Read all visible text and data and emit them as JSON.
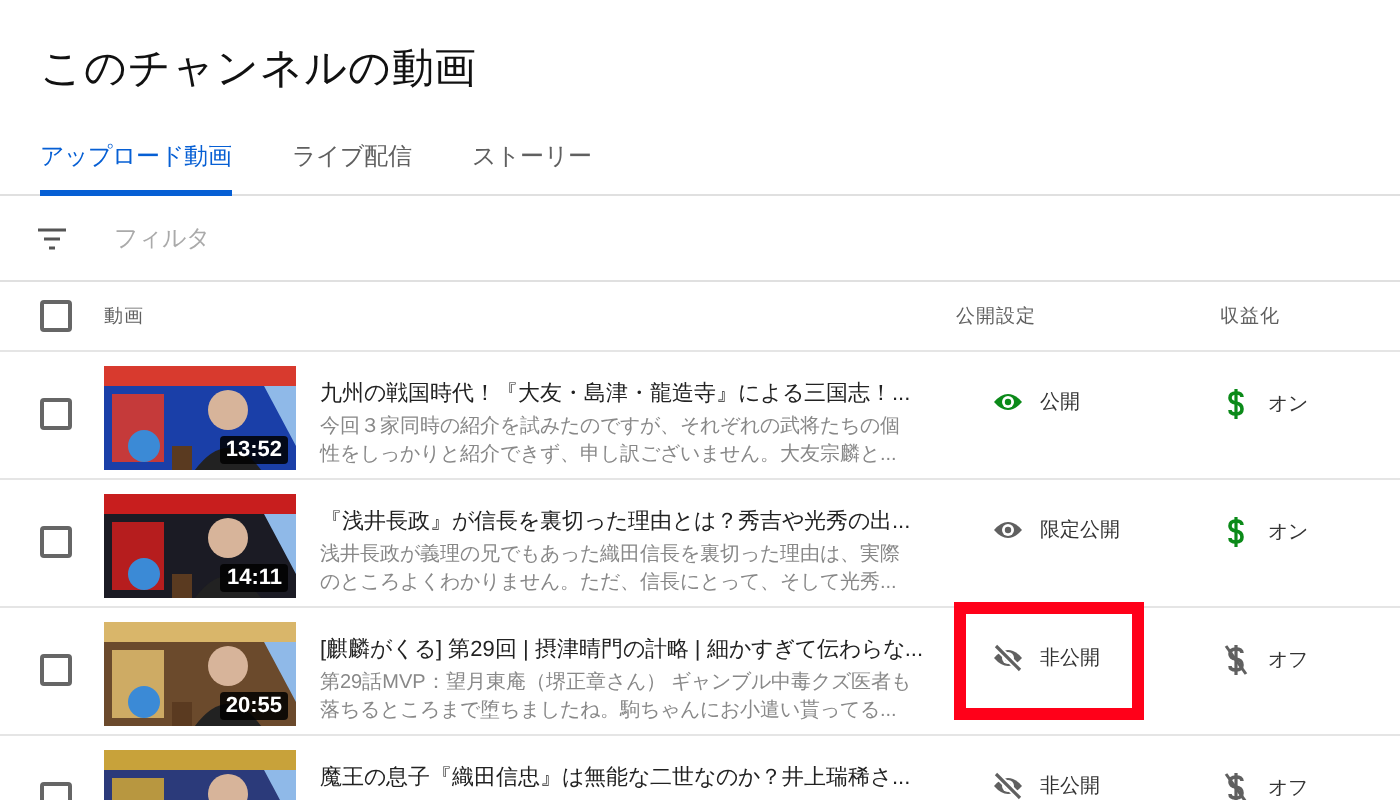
{
  "page": {
    "title": "このチャンネルの動画"
  },
  "tabs": [
    {
      "label": "アップロード動画",
      "selected": true
    },
    {
      "label": "ライブ配信",
      "selected": false
    },
    {
      "label": "ストーリー",
      "selected": false
    }
  ],
  "filter": {
    "placeholder": "フィルタ"
  },
  "table": {
    "select_all": {
      "checked": false
    },
    "columns": [
      "動画",
      "公開設定",
      "収益化"
    ],
    "rows": [
      {
        "checked": false,
        "duration": "13:52",
        "title": "九州の戦国時代！『大友・島津・龍造寺』による三国志！...",
        "description": "今回３家同時の紹介を試みたのですが、それぞれの武将たちの個性をしっかりと紹介できず、申し訳ございません。大友宗麟と...",
        "visibility": {
          "kind": "public",
          "label": "公開"
        },
        "monetization": {
          "kind": "on",
          "label": "オン"
        },
        "highlighted": false
      },
      {
        "checked": false,
        "duration": "14:11",
        "title": "『浅井長政』が信長を裏切った理由とは？秀吉や光秀の出...",
        "description": "浅井長政が義理の兄でもあった織田信長を裏切った理由は、実際のところよくわかりません。ただ、信長にとって、そして光秀...",
        "visibility": {
          "kind": "unlisted",
          "label": "限定公開"
        },
        "monetization": {
          "kind": "on",
          "label": "オン"
        },
        "highlighted": false
      },
      {
        "checked": false,
        "duration": "20:55",
        "title": "[麒麟がくる] 第29回 | 摂津晴門の計略 | 細かすぎて伝わらな...",
        "description": "第29話MVP：望月東庵（堺正章さん） ギャンブル中毒クズ医者も落ちるところまで堕ちましたね。駒ちゃんにお小遣い貰ってる...",
        "visibility": {
          "kind": "private",
          "label": "非公開"
        },
        "monetization": {
          "kind": "off",
          "label": "オフ"
        },
        "highlighted": true
      },
      {
        "checked": false,
        "title": "魔王の息子『織田信忠』は無能な二世なのか？井上瑞稀さ...",
        "visibility": {
          "kind": "private",
          "label": "非公開"
        },
        "monetization": {
          "kind": "off",
          "label": "オフ"
        },
        "highlighted": false
      }
    ]
  }
}
